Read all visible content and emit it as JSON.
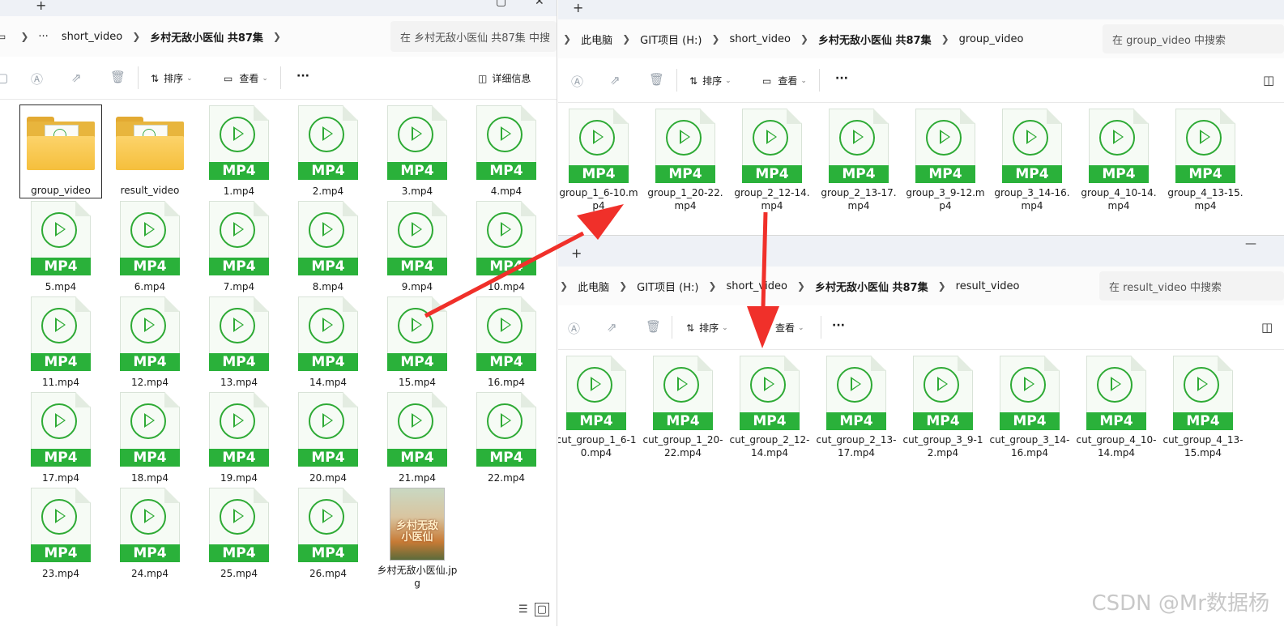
{
  "left_window": {
    "address": {
      "crumbs": [
        "···",
        "short_video",
        "乡村无敌小医仙  共87集"
      ],
      "search_placeholder": "在 乡村无敌小医仙  共87集 中搜"
    },
    "toolbar": {
      "sort_label": "排序",
      "view_label": "查看",
      "more_label": "···",
      "details_label": "详细信息"
    },
    "items": [
      {
        "name": "group_video",
        "type": "folder",
        "selected": true
      },
      {
        "name": "result_video",
        "type": "folder",
        "selected": false
      },
      {
        "name": "1.mp4",
        "type": "mp4"
      },
      {
        "name": "2.mp4",
        "type": "mp4"
      },
      {
        "name": "3.mp4",
        "type": "mp4"
      },
      {
        "name": "4.mp4",
        "type": "mp4"
      },
      {
        "name": "5.mp4",
        "type": "mp4"
      },
      {
        "name": "6.mp4",
        "type": "mp4"
      },
      {
        "name": "7.mp4",
        "type": "mp4"
      },
      {
        "name": "8.mp4",
        "type": "mp4"
      },
      {
        "name": "9.mp4",
        "type": "mp4"
      },
      {
        "name": "10.mp4",
        "type": "mp4"
      },
      {
        "name": "11.mp4",
        "type": "mp4"
      },
      {
        "name": "12.mp4",
        "type": "mp4"
      },
      {
        "name": "13.mp4",
        "type": "mp4"
      },
      {
        "name": "14.mp4",
        "type": "mp4"
      },
      {
        "name": "15.mp4",
        "type": "mp4"
      },
      {
        "name": "16.mp4",
        "type": "mp4"
      },
      {
        "name": "17.mp4",
        "type": "mp4"
      },
      {
        "name": "18.mp4",
        "type": "mp4"
      },
      {
        "name": "19.mp4",
        "type": "mp4"
      },
      {
        "name": "20.mp4",
        "type": "mp4"
      },
      {
        "name": "21.mp4",
        "type": "mp4"
      },
      {
        "name": "22.mp4",
        "type": "mp4"
      },
      {
        "name": "23.mp4",
        "type": "mp4"
      },
      {
        "name": "24.mp4",
        "type": "mp4"
      },
      {
        "name": "25.mp4",
        "type": "mp4"
      },
      {
        "name": "26.mp4",
        "type": "mp4"
      },
      {
        "name": "乡村无敌小医仙.jpg",
        "type": "jpg",
        "poster_title": "乡村无敌小医仙"
      }
    ]
  },
  "group_window": {
    "address": {
      "crumbs": [
        "此电脑",
        "GIT项目 (H:)",
        "short_video",
        "乡村无敌小医仙  共87集",
        "group_video"
      ],
      "search_placeholder": "在 group_video 中搜索"
    },
    "toolbar": {
      "sort_label": "排序",
      "view_label": "查看",
      "more_label": "···"
    },
    "items": [
      {
        "name": "group_1_6-10.mp4"
      },
      {
        "name": "group_1_20-22.mp4"
      },
      {
        "name": "group_2_12-14.mp4"
      },
      {
        "name": "group_2_13-17.mp4"
      },
      {
        "name": "group_3_9-12.mp4"
      },
      {
        "name": "group_3_14-16.mp4"
      },
      {
        "name": "group_4_10-14.mp4"
      },
      {
        "name": "group_4_13-15.mp4"
      }
    ]
  },
  "result_window": {
    "address": {
      "crumbs": [
        "此电脑",
        "GIT项目 (H:)",
        "short_video",
        "乡村无敌小医仙  共87集",
        "result_video"
      ],
      "search_placeholder": "在 result_video 中搜索"
    },
    "toolbar": {
      "sort_label": "排序",
      "view_label": "查看",
      "more_label": "···"
    },
    "items": [
      {
        "name": "cut_group_1_6-10.mp4"
      },
      {
        "name": "cut_group_1_20-22.mp4"
      },
      {
        "name": "cut_group_2_12-14.mp4"
      },
      {
        "name": "cut_group_2_13-17.mp4"
      },
      {
        "name": "cut_group_3_9-12.mp4"
      },
      {
        "name": "cut_group_3_14-16.mp4"
      },
      {
        "name": "cut_group_4_10-14.mp4"
      },
      {
        "name": "cut_group_4_13-15.mp4"
      }
    ]
  },
  "file_badge": "MP4",
  "tab_plus": "+",
  "watermark": "CSDN @Mr数据杨",
  "colors": {
    "mp4_green": "#2ab13a",
    "arrow_red": "#f0302a",
    "folder_yellow": "#f5bf3c"
  }
}
